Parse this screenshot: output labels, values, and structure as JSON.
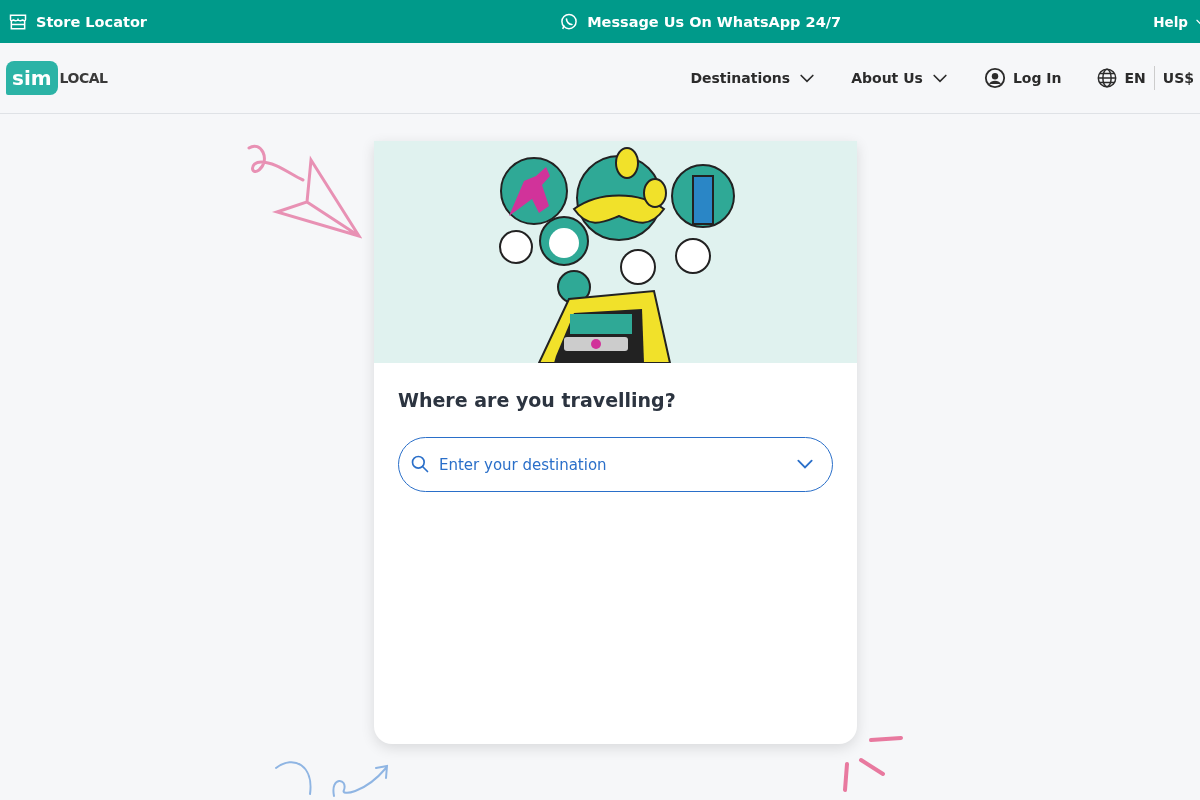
{
  "top_bar": {
    "store_locator": "Store Locator",
    "whatsapp": "Message Us On WhatsApp 24/7",
    "help": "Help"
  },
  "header": {
    "logo": {
      "badge": "sim",
      "word": "LOCAL"
    },
    "menu": [
      {
        "kind": "dropdown",
        "label": "Destinations"
      },
      {
        "kind": "dropdown",
        "label": "About Us"
      },
      {
        "kind": "account",
        "label": "Log In"
      }
    ],
    "language": "EN",
    "currency": "US$"
  },
  "card": {
    "heading": "Where are you travelling?",
    "search": {
      "placeholder": "Enter your destination"
    }
  }
}
